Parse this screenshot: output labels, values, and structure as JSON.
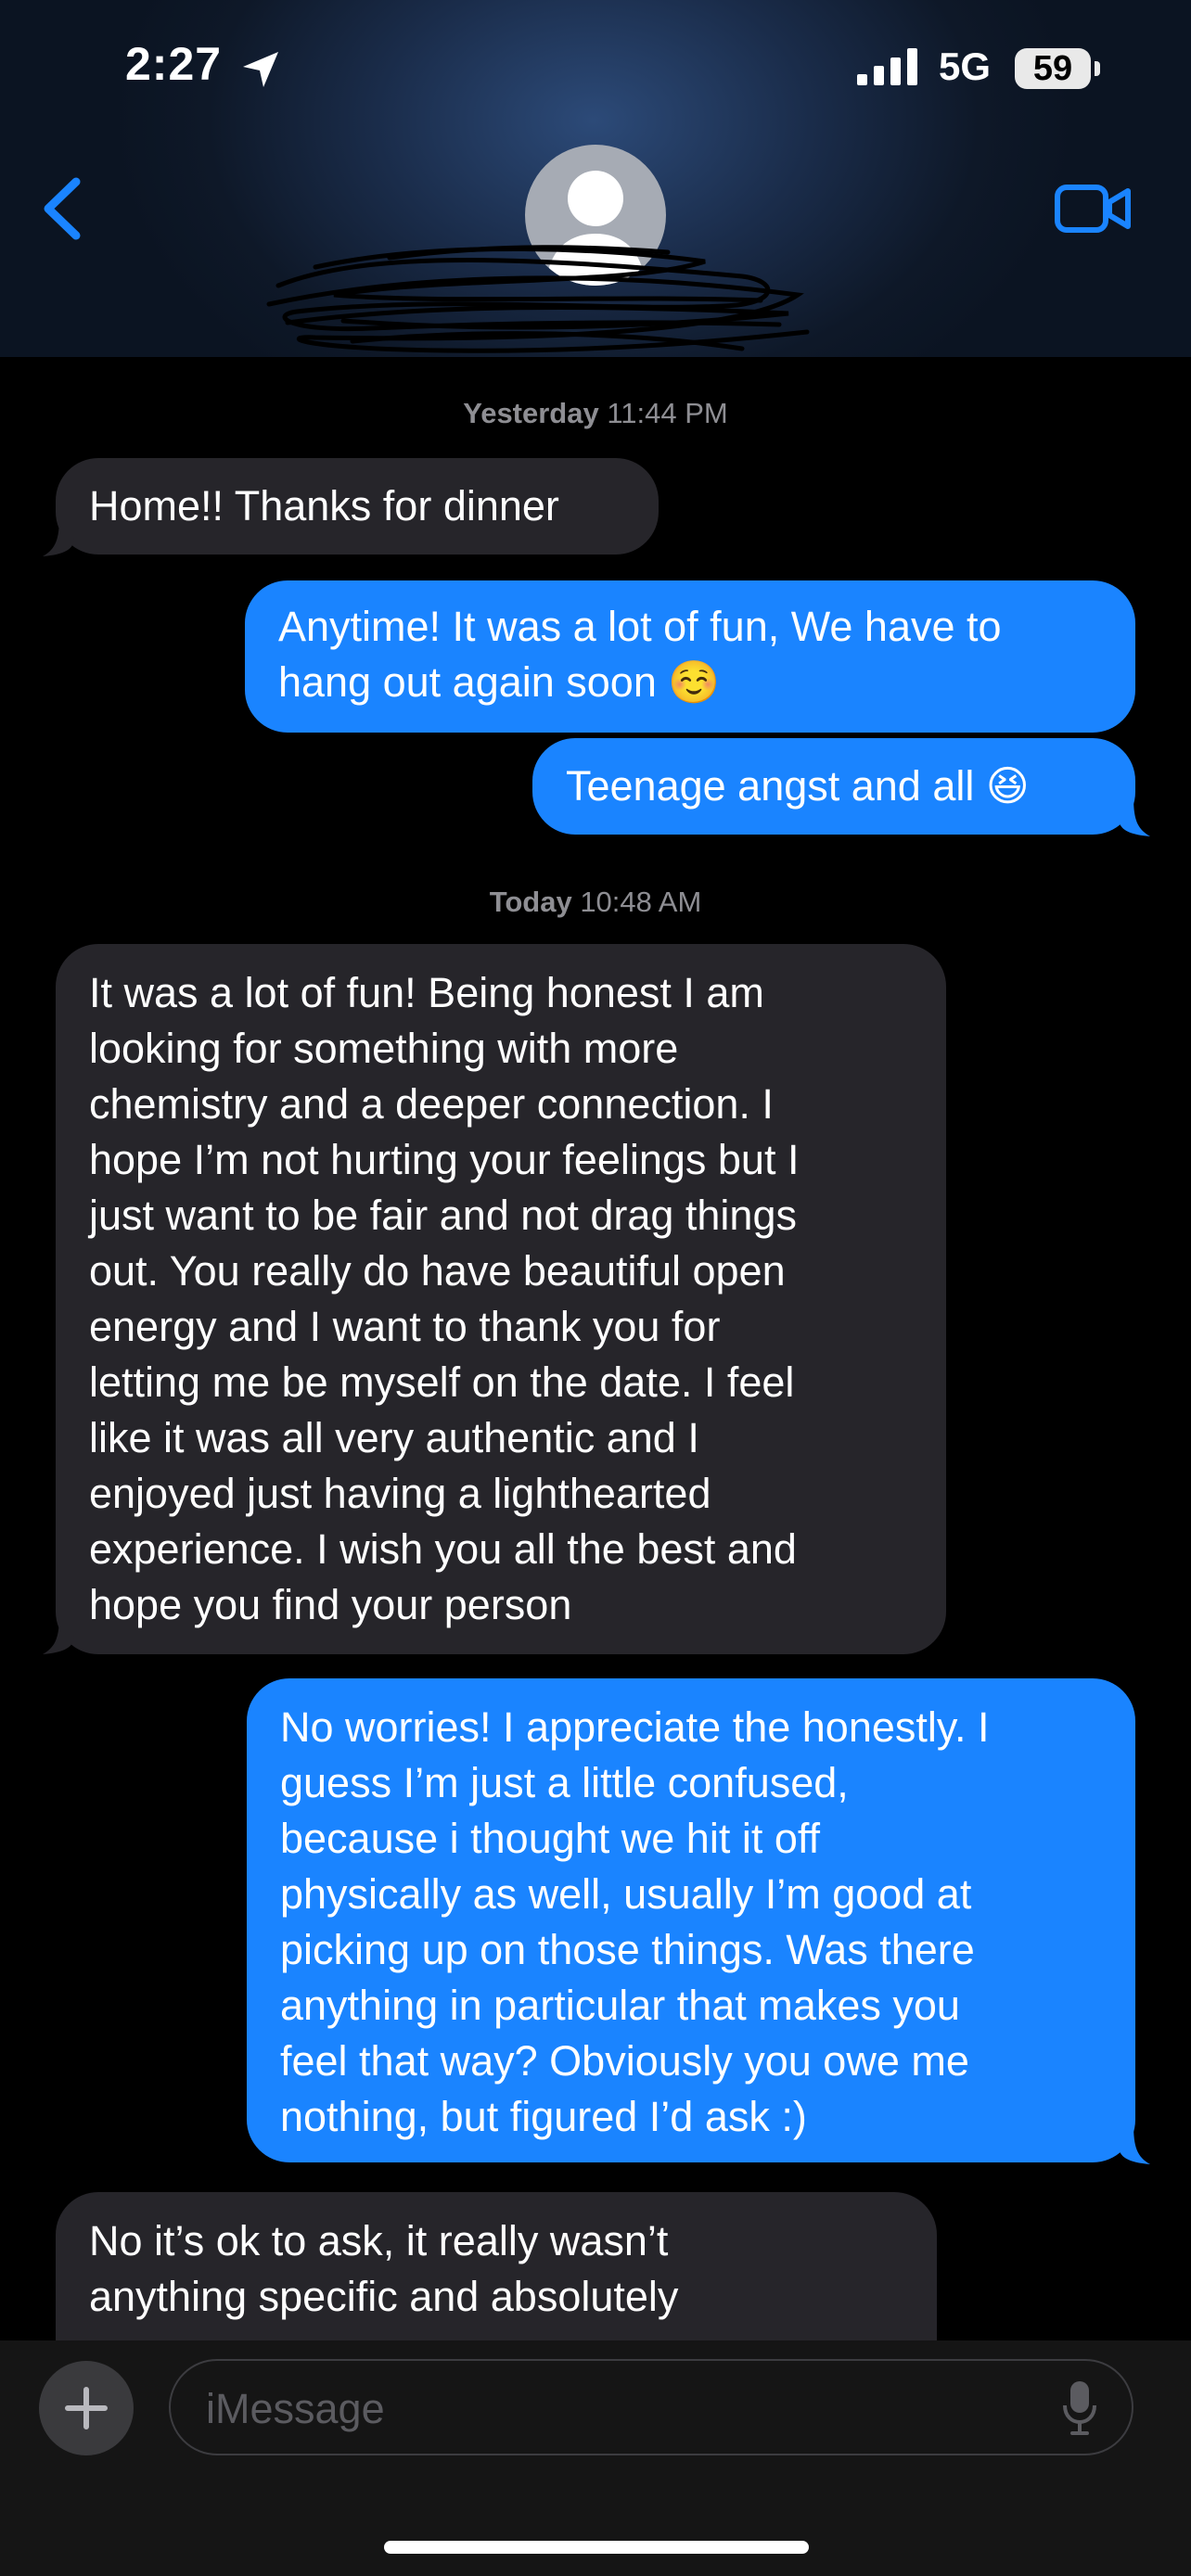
{
  "status_bar": {
    "time": "2:27",
    "network": "5G",
    "battery": "59"
  },
  "header": {
    "back_icon": "chevron-left-icon",
    "video_icon": "video-camera-icon",
    "avatar_icon": "person-icon",
    "accent_color": "#1a84ff"
  },
  "messages": {
    "ts1_day": "Yesterday",
    "ts1_time": " 11:44 PM",
    "m1": "Home!! Thanks for dinner",
    "m2_line1": "Anytime! It was a lot of fun, We have to",
    "m2_line2": "hang out again soon ☺️",
    "m3": "Teenage angst and all 😆",
    "ts2_day": "Today",
    "ts2_time": " 10:48 AM",
    "m4_lines": [
      "It was a lot of fun! Being honest I am",
      "looking for something with more",
      "chemistry and a deeper connection. I",
      "hope I’m not hurting your feelings but I",
      "just want to be fair and not drag things",
      "out. You really do have beautiful open",
      "energy and I want to thank you for",
      "letting me be myself on the date. I feel",
      "like it was all very authentic and I",
      "enjoyed just having a lighthearted",
      "experience. I wish you all the best and",
      "hope you find your person"
    ],
    "m5_lines": [
      "No worries! I appreciate the honestly. I",
      "guess I’m just a little confused,",
      "because i thought we hit it off",
      "physically as well, usually I’m good at",
      "picking up on those things. Was there",
      "anything in particular that makes you",
      "feel that way? Obviously you owe me",
      "nothing, but figured I’d ask :)"
    ],
    "m6_lines": [
      "No it’s ok to ask, it really wasn’t",
      "anything specific and absolutely"
    ]
  },
  "composer": {
    "placeholder": "iMessage",
    "plus_icon": "plus-icon",
    "mic_icon": "microphone-icon"
  }
}
